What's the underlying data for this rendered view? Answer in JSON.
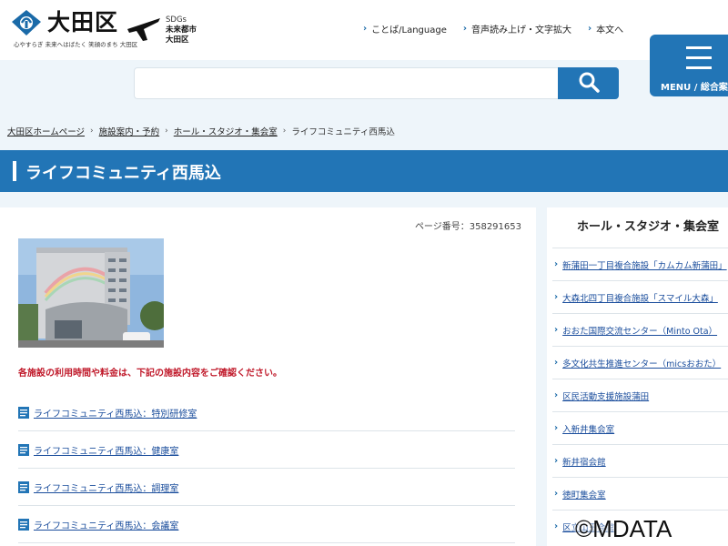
{
  "header": {
    "logo_name": "大田区",
    "logo_tagline": "心やすらぎ 未来へはばたく 笑顔のまち 大田区",
    "sdgs_lines": [
      "SDGs",
      "未来都市",
      "大田区"
    ],
    "utility_links": [
      {
        "label": "ことば/Language"
      },
      {
        "label": "音声読み上げ・文字拡大"
      },
      {
        "label": "本文へ"
      }
    ],
    "menu_label": "MENU / 総合案内"
  },
  "search": {
    "value": "",
    "icon": "search-icon"
  },
  "breadcrumb": {
    "items": [
      "大田区ホームページ",
      "施設案内・予約",
      "ホール・スタジオ・集会室"
    ],
    "current": "ライフコミュニティ西馬込"
  },
  "page": {
    "title": "ライフコミュニティ西馬込",
    "page_number": "ページ番号：358291653",
    "notice": "各施設の利用時間や料金は、下記の施設内容をご確認ください。",
    "links": [
      {
        "label": "ライフコミュニティ西馬込：特別研修室"
      },
      {
        "label": "ライフコミュニティ西馬込：健康室"
      },
      {
        "label": "ライフコミュニティ西馬込：調理室"
      },
      {
        "label": "ライフコミュニティ西馬込：会議室"
      }
    ]
  },
  "sidebar": {
    "title": "ホール・スタジオ・集会室",
    "items": [
      {
        "label": "新蒲田一丁目複合施設「カムカム新蒲田」"
      },
      {
        "label": "大森北四丁目複合施設「スマイル大森」"
      },
      {
        "label": "おおた国際交流センター（Minto Ota）"
      },
      {
        "label": "多文化共生推進センター（micsおおた）"
      },
      {
        "label": "区民活動支援施設蒲田"
      },
      {
        "label": "入新井集会室"
      },
      {
        "label": "新井宿会館"
      },
      {
        "label": "徳町集会室"
      },
      {
        "label": "区立山王会館"
      }
    ]
  },
  "watermark": "©MDATA",
  "colors": {
    "brand_blue": "#2275b6",
    "notice_red": "#c0192a",
    "link_blue": "#1a4d9c",
    "page_bg": "#eef5fa"
  }
}
